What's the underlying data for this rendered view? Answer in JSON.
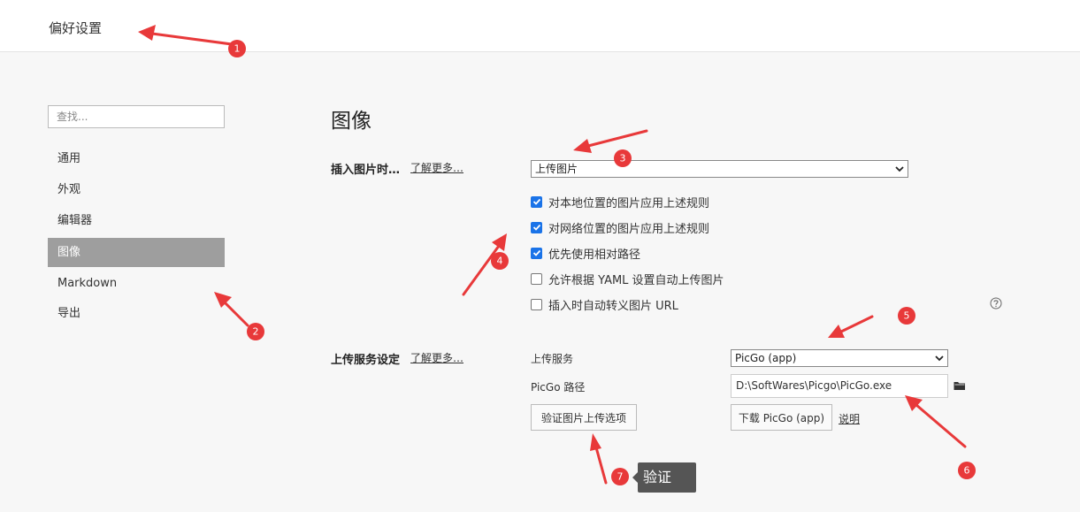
{
  "window": {
    "title": "偏好设置"
  },
  "sidebar": {
    "search_placeholder": "查找...",
    "items": [
      {
        "label": "通用",
        "active": false
      },
      {
        "label": "外观",
        "active": false
      },
      {
        "label": "编辑器",
        "active": false
      },
      {
        "label": "图像",
        "active": true
      },
      {
        "label": "Markdown",
        "active": false
      },
      {
        "label": "导出",
        "active": false
      }
    ]
  },
  "main": {
    "heading": "图像",
    "insert_image": {
      "label": "插入图片时…",
      "learn_more": "了解更多…",
      "action_select": "上传图片",
      "options": [
        {
          "label": "对本地位置的图片应用上述规则",
          "checked": true
        },
        {
          "label": "对网络位置的图片应用上述规则",
          "checked": true
        },
        {
          "label": "优先使用相对路径",
          "checked": true
        },
        {
          "label": "允许根据 YAML 设置自动上传图片",
          "checked": false
        },
        {
          "label": "插入时自动转义图片 URL",
          "checked": false
        }
      ]
    },
    "upload_service": {
      "label": "上传服务设定",
      "learn_more": "了解更多…",
      "service_label": "上传服务",
      "service_value": "PicGo (app)",
      "path_label": "PicGo 路径",
      "path_value": "D:\\SoftWares\\Picgo\\PicGo.exe",
      "verify_button": "验证图片上传选项",
      "download_button": "下载 PicGo (app)",
      "explain_link": "说明"
    }
  },
  "tooltip": {
    "text": "验证"
  },
  "annotations": {
    "color": "#e8393a",
    "badges": [
      "1",
      "2",
      "3",
      "4",
      "5",
      "6",
      "7"
    ]
  },
  "colors": {
    "checkbox_accent": "#1a73e8",
    "active_nav": "#9e9e9e"
  },
  "icons": {
    "help": "question-circle-icon",
    "folder": "folder-icon",
    "chevron": "chevron-down-icon"
  }
}
